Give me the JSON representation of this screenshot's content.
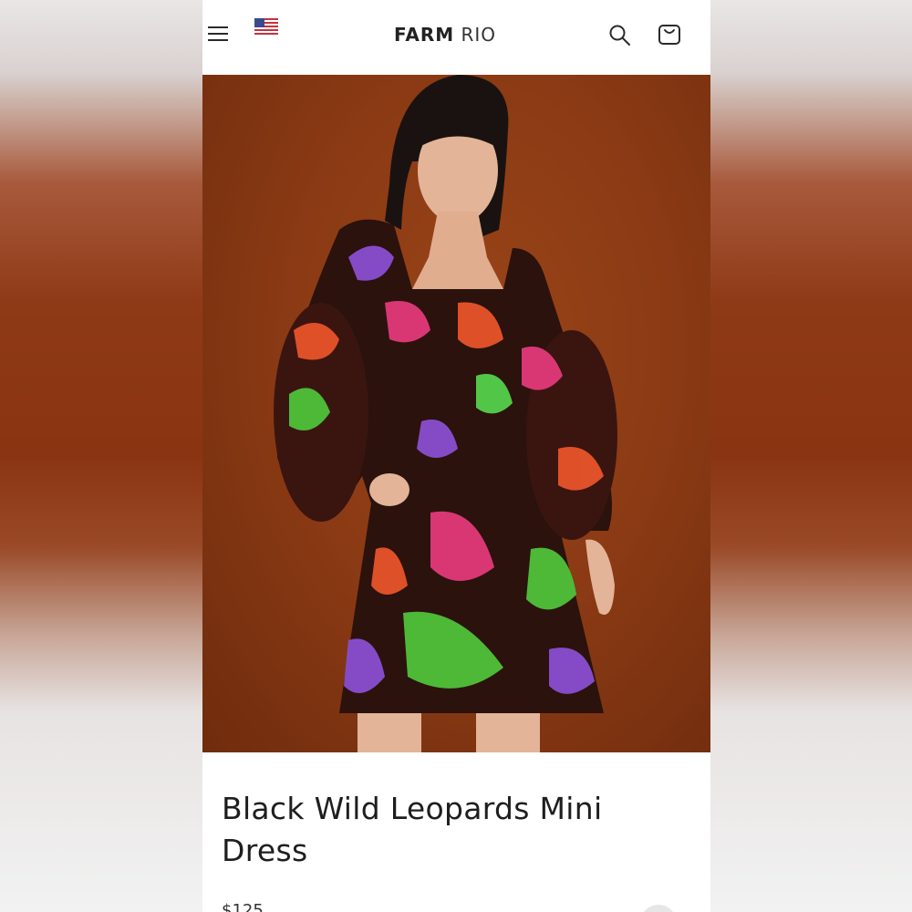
{
  "header": {
    "menu_icon": "hamburger-menu-icon",
    "flag_icon": "us-flag-icon",
    "logo_bold": "FARM",
    "logo_light": "RIO",
    "search_icon": "search-icon",
    "bag_icon": "shopping-bag-icon"
  },
  "product": {
    "image_alt": "Model wearing Black Wild Leopards Mini Dress",
    "title": "Black Wild Leopards Mini Dress",
    "price": "$125"
  },
  "colors": {
    "backdrop_brown": "#8a3412",
    "hero_background": "#8a3a14",
    "text": "#1e1e1e"
  }
}
